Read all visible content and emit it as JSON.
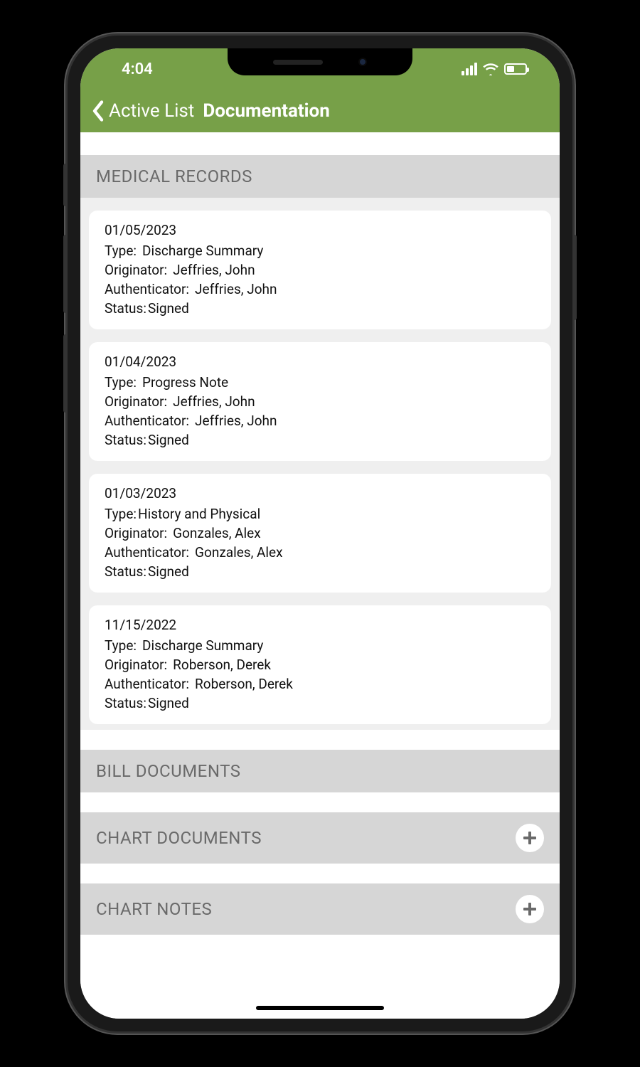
{
  "status": {
    "time": "4:04"
  },
  "nav": {
    "back_label": "Active List",
    "title": "Documentation"
  },
  "labels": {
    "type": "Type:",
    "originator": "Originator:",
    "authenticator": "Authenticator:",
    "status": "Status:"
  },
  "sections": {
    "medical_records": {
      "title": "MEDICAL RECORDS",
      "has_add": false
    },
    "bill_documents": {
      "title": "BILL DOCUMENTS",
      "has_add": false
    },
    "chart_documents": {
      "title": "CHART DOCUMENTS",
      "has_add": true
    },
    "chart_notes": {
      "title": "CHART NOTES",
      "has_add": true
    }
  },
  "medical_records": [
    {
      "date": "01/05/2023",
      "type": "Discharge Summary",
      "originator": "Jeffries, John",
      "authenticator": "Jeffries, John",
      "status": "Signed"
    },
    {
      "date": "01/04/2023",
      "type": "Progress Note",
      "originator": "Jeffries, John",
      "authenticator": "Jeffries, John",
      "status": "Signed"
    },
    {
      "date": "01/03/2023",
      "type": "History and Physical",
      "originator": "Gonzales, Alex",
      "authenticator": "Gonzales, Alex",
      "status": "Signed"
    },
    {
      "date": "11/15/2022",
      "type": "Discharge Summary",
      "originator": "Roberson, Derek",
      "authenticator": "Roberson, Derek",
      "status": "Signed"
    }
  ]
}
